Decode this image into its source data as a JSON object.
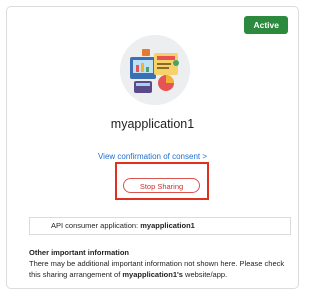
{
  "status": {
    "label": "Active",
    "color": "#2b8a3e"
  },
  "app": {
    "name": "myapplication1",
    "logo_icon": "budget-planning-illustration-icon"
  },
  "consent_link": {
    "label": "View confirmation of consent >"
  },
  "stop_button": {
    "label": "Stop Sharing",
    "color": "#c9302c"
  },
  "consumer": {
    "label": "API consumer application:",
    "value": "myapplication1"
  },
  "info": {
    "heading": "Other important information",
    "body_start": "There may be additional important information not shown here. Please check this sharing arrangement of ",
    "body_app": "myapplication1's",
    "body_end": " website/app."
  },
  "highlight_color": "#e0301e"
}
